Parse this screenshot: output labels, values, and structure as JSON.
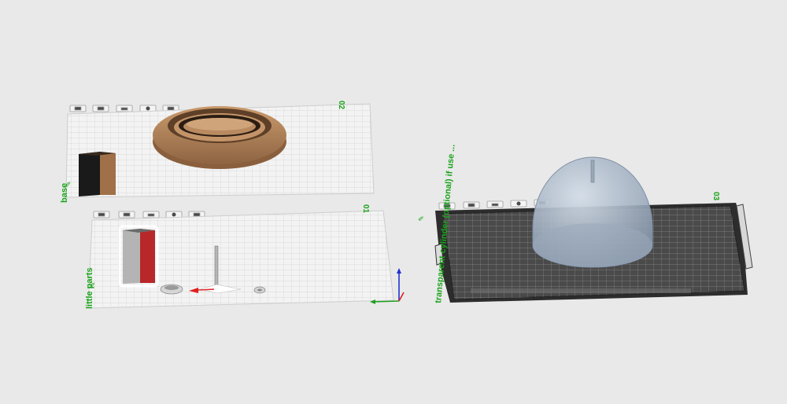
{
  "plates": [
    {
      "id": "plate-02",
      "number": "02",
      "name": "base",
      "edit_mark": "✎",
      "toolbar": [
        "arrange-icon",
        "orient-icon",
        "lock-icon",
        "select-icon",
        "settings-icon"
      ],
      "objects": [
        "ring-dish",
        "block-part"
      ]
    },
    {
      "id": "plate-01",
      "number": "01",
      "name": "little parts",
      "edit_mark": "✎",
      "toolbar": [
        "arrange-icon",
        "orient-icon",
        "lock-icon",
        "select-icon",
        "settings-icon"
      ],
      "objects": [
        "box-part-selected",
        "small-bowl",
        "pin-rod",
        "nut-part"
      ]
    },
    {
      "id": "plate-03",
      "number": "03",
      "name": "transparent cylinder (optional) if use ...",
      "edit_mark": "✎",
      "toolbar": [
        "arrange-icon",
        "orient-icon",
        "lock-icon",
        "select-icon",
        "settings-icon"
      ],
      "objects": [
        "transparent-dome"
      ]
    }
  ],
  "colors": {
    "background": "#e9e9e9",
    "plate_label": "#1aa31a",
    "wood": "#b98a60",
    "selection": "#ffffff",
    "red_part": "#b8282a",
    "dark_bed": "#3b3b3b",
    "dome": "#a9b8c8"
  },
  "axes": {
    "x_color": "#e02020",
    "y_color": "#20a020",
    "z_color": "#2030d0"
  }
}
